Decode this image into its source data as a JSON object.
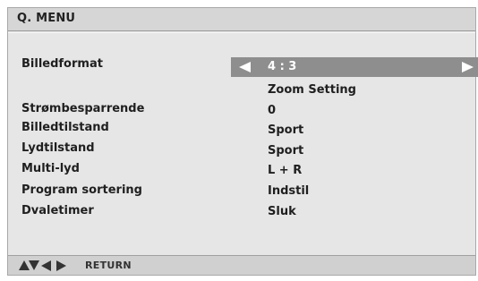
{
  "header": {
    "title": "Q. MENU"
  },
  "menu": {
    "items": [
      {
        "label": "Billedformat",
        "value": "4 : 3"
      },
      {
        "label": "",
        "value": "Zoom Setting"
      },
      {
        "label": "Strømbesparrende",
        "value": "0"
      },
      {
        "label": "Billedtilstand",
        "value": "Sport"
      },
      {
        "label": "Lydtilstand",
        "value": "Sport"
      },
      {
        "label": "Multi-lyd",
        "value": "L + R"
      },
      {
        "label": "Program sortering",
        "value": "Indstil"
      },
      {
        "label": "Dvaletimer",
        "value": "Sluk"
      }
    ],
    "selected_index": 0
  },
  "footer": {
    "icons": [
      "up-arrow-icon",
      "down-arrow-icon",
      "left-arrow-icon",
      "right-arrow-icon"
    ],
    "return_label": "RETURN"
  },
  "colors": {
    "panel": "#e6e6e6",
    "header": "#d6d6d6",
    "selector": "#8e8e8e",
    "footer": "#d0d0d0",
    "text": "#1f1f1f"
  }
}
